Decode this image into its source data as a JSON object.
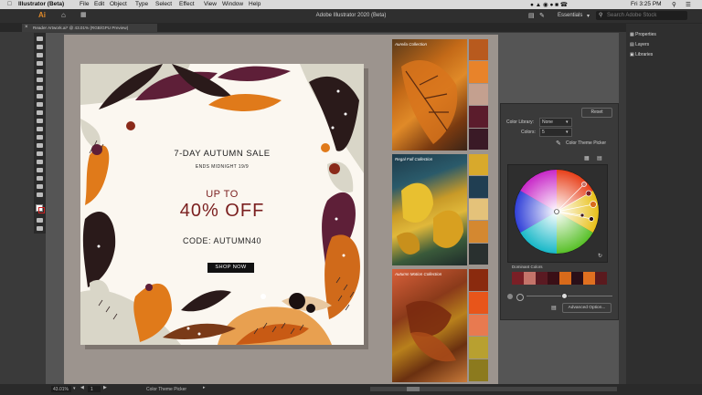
{
  "menubar": {
    "app": "Illustrator (Beta)",
    "items": [
      "File",
      "Edit",
      "Object",
      "Type",
      "Select",
      "Effect",
      "View",
      "Window",
      "Help"
    ],
    "clock": "Fri 3:25 PM"
  },
  "appbar": {
    "title": "Adobe Illustrator 2020 (Beta)",
    "workspace": "Essentials",
    "search_placeholder": "Search Adobe Stock"
  },
  "doc_tab": {
    "label": "Reader Artwork.ai* @ 43.01% (RGB/GPU Preview)"
  },
  "right_panel": {
    "items": [
      "Properties",
      "Layers",
      "Libraries"
    ]
  },
  "artboard": {
    "headline": "7-DAY AUTUMN SALE",
    "subline": "ENDS MIDNIGHT 19/9",
    "upto": "UP TO",
    "discount": "40% OFF",
    "code": "CODE: AUTUMN40",
    "cta": "SHOP NOW"
  },
  "photos": [
    {
      "label": "Aurelia Collection",
      "swatches": [
        "#b85a1e",
        "#e8832a",
        "#c4a08f",
        "#5b1c2c",
        "#3a1a26"
      ]
    },
    {
      "label": "Regal Fall Collection",
      "swatches": [
        "#d8a92c",
        "#203e52",
        "#e4c27a",
        "#d48830",
        "#29302f"
      ]
    },
    {
      "label": "Autumn Motion Collection",
      "swatches": [
        "#8a2a0e",
        "#e8551a",
        "#e87a50",
        "#b8a030",
        "#8c7a1e"
      ]
    }
  ],
  "theme_picker": {
    "reset": "Reset",
    "library_label": "Color Library:",
    "library_value": "None",
    "colors_label": "Colors:",
    "colors_value": "5",
    "title": "Color Theme Picker",
    "dominant_label": "Dominant Colors",
    "advanced": "Advanced Option...",
    "dominant_colors": [
      "#7a1f26",
      "#c4746a",
      "#5a1a22",
      "#3a0f16",
      "#d86a1a",
      "#2a0f18",
      "#e07020",
      "#5a1a1e"
    ]
  },
  "statusbar": {
    "zoom": "43.01%",
    "page": "1",
    "tool": "Color Theme Picker"
  }
}
